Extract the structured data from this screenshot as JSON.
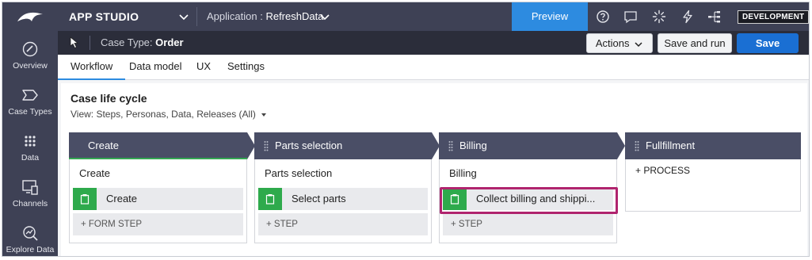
{
  "app": {
    "title": "APP STUDIO",
    "application_label": "Application :",
    "application_value": "RefreshData",
    "preview_label": "Preview",
    "environment_badge": "DEVELOPMENT"
  },
  "top_icons": [
    "help-icon",
    "chat-icon",
    "loading-spinner-icon",
    "lightning-icon",
    "hierarchy-icon"
  ],
  "casebar": {
    "case_type_label": "Case Type:",
    "case_type_value": "Order",
    "actions_label": "Actions",
    "save_and_run_label": "Save and run",
    "save_label": "Save"
  },
  "leftnav": {
    "items": [
      {
        "label": "Overview",
        "icon": "overview-icon"
      },
      {
        "label": "Case Types",
        "icon": "case-types-icon"
      },
      {
        "label": "Data",
        "icon": "data-icon"
      },
      {
        "label": "Channels",
        "icon": "channels-icon"
      },
      {
        "label": "Explore Data",
        "icon": "explore-data-icon"
      }
    ]
  },
  "tabs": [
    {
      "label": "Workflow",
      "active": true
    },
    {
      "label": "Data model",
      "active": false
    },
    {
      "label": "UX",
      "active": false
    },
    {
      "label": "Settings",
      "active": false
    }
  ],
  "lifecycle": {
    "title": "Case life cycle",
    "view_label": "View: Steps, Personas, Data, Releases (All)",
    "stages": [
      {
        "name": "Create",
        "process": "Create",
        "step": "Create",
        "add_label": "+ FORM STEP"
      },
      {
        "name": "Parts selection",
        "process": "Parts selection",
        "step": "Select parts",
        "add_label": "+ STEP"
      },
      {
        "name": "Billing",
        "process": "Billing",
        "step": "Collect billing and shippi...",
        "add_label": "+ STEP"
      },
      {
        "name": "Fullfillment",
        "add_process_label": "+ PROCESS"
      }
    ]
  },
  "colors": {
    "topbar": "#3e4155",
    "casebar": "#2b2d3a",
    "stage_header": "#4a4e66",
    "step_icon_green": "#2eaa4c",
    "highlight": "#b0246e",
    "primary_blue": "#1a6fd3",
    "preview_blue": "#2d8be0"
  }
}
